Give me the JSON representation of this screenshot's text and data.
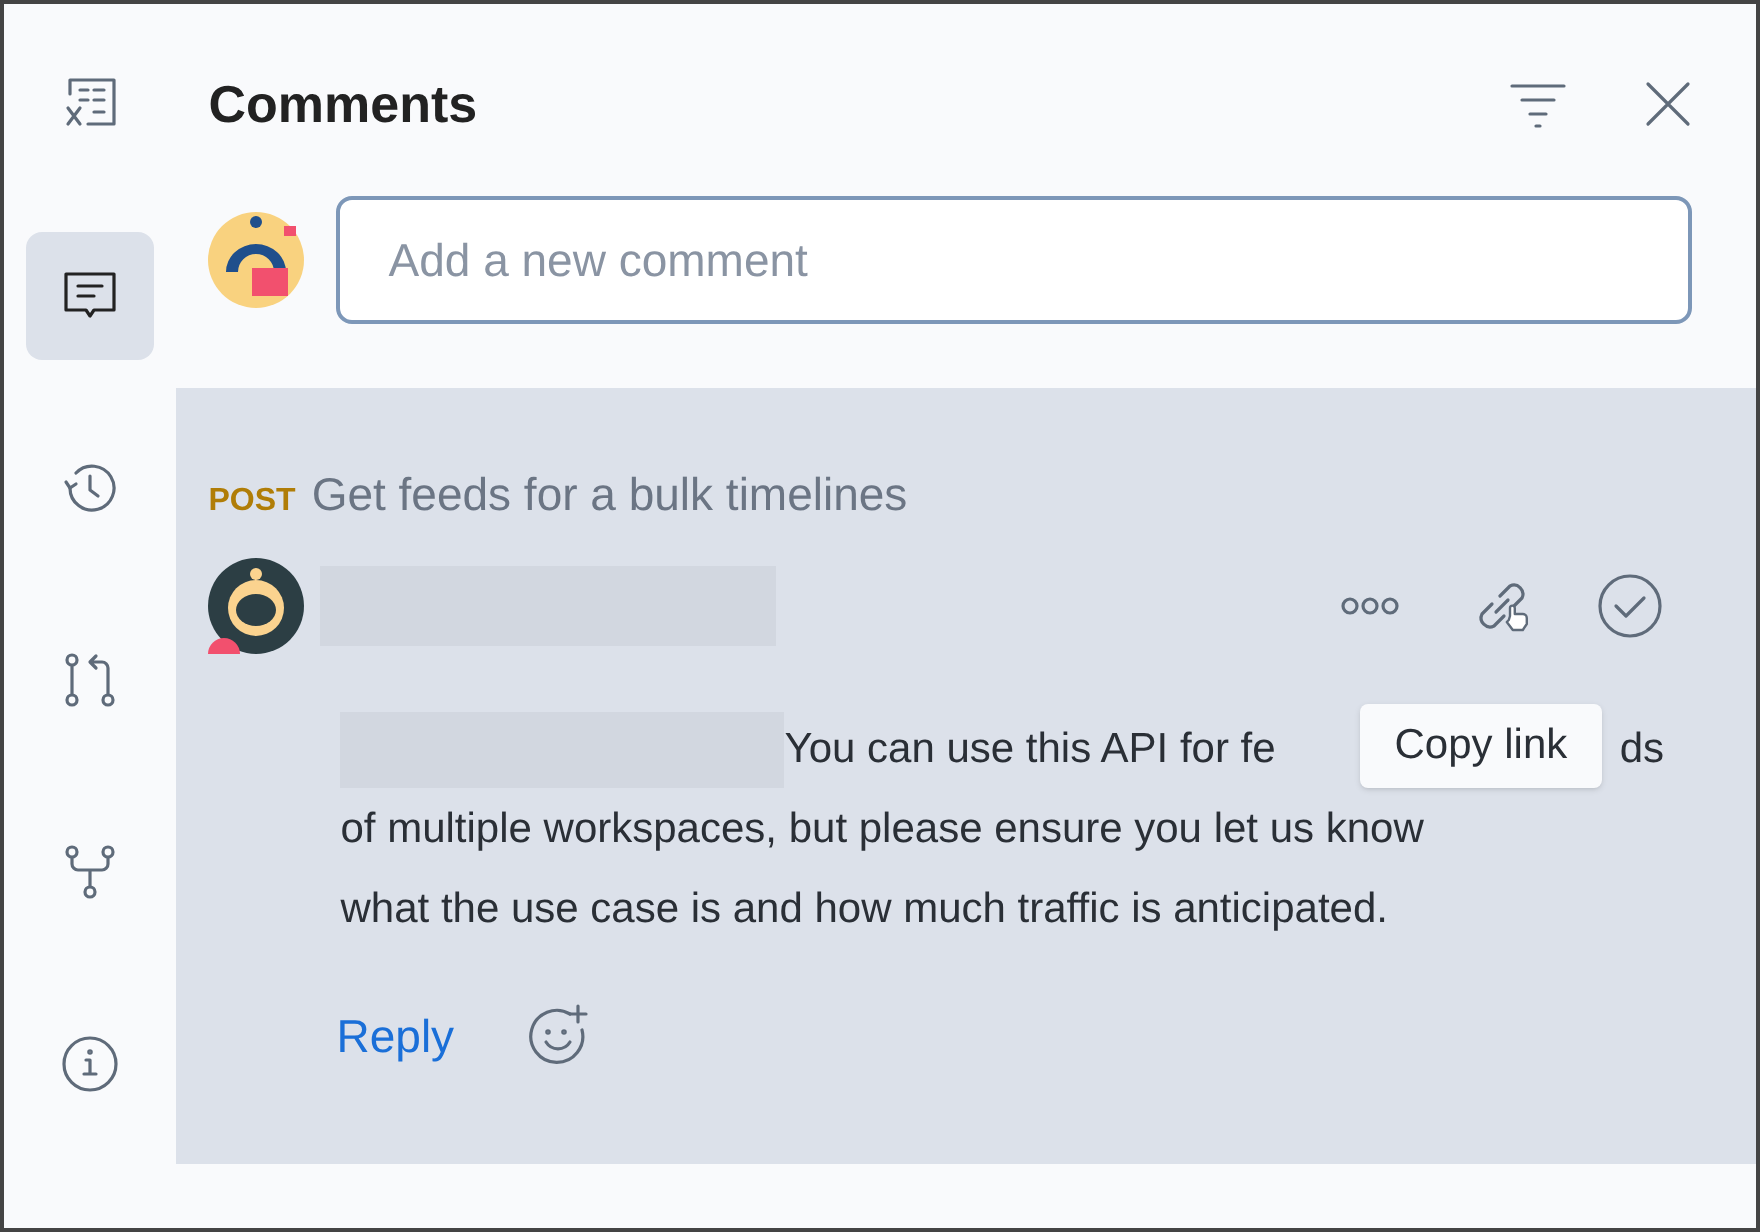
{
  "sidebar": {
    "items": [
      {
        "kind": "variables",
        "selected": false
      },
      {
        "kind": "comments",
        "selected": true
      },
      {
        "kind": "history",
        "selected": false
      },
      {
        "kind": "pull",
        "selected": false
      },
      {
        "kind": "fork",
        "selected": false
      },
      {
        "kind": "info",
        "selected": false
      }
    ]
  },
  "header": {
    "title": "Comments"
  },
  "new_comment": {
    "placeholder": "Add a new comment"
  },
  "thread": {
    "method": "POST",
    "endpoint": "Get feeds for a bulk timelines",
    "comment": {
      "line_1_start": "You can use this API for fe",
      "line_1_end": "ds",
      "line_2": "of multiple workspaces, but please ensure you let us know",
      "line_3": "what the use case is and how much traffic is anticipated."
    },
    "tooltip": "Copy link",
    "reply": "Reply"
  }
}
